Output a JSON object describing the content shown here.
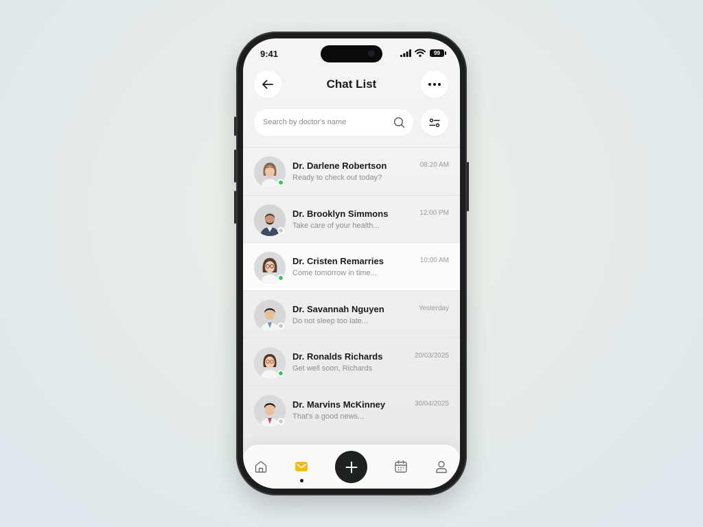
{
  "status_bar": {
    "time": "9:41",
    "battery": "99"
  },
  "header": {
    "title": "Chat List"
  },
  "search": {
    "placeholder": "Search by doctor's name"
  },
  "chats": [
    {
      "name": "Dr. Darlene Robertson",
      "message": "Ready to check out today?",
      "time": "08:20 AM",
      "online": true
    },
    {
      "name": "Dr. Brooklyn Simmons",
      "message": "Take care of your health...",
      "time": "12:00 PM",
      "online": false
    },
    {
      "name": "Dr. Cristen Remarries",
      "message": "Come tomorrow in time...",
      "time": "10:00 AM",
      "online": true
    },
    {
      "name": "Dr. Savannah Nguyen",
      "message": "Do not sleep too late...",
      "time": "Yesterday",
      "online": false
    },
    {
      "name": "Dr. Ronalds Richards",
      "message": "Get well soon, Richards",
      "time": "20/03/2025",
      "online": true
    },
    {
      "name": "Dr. Marvins McKinney",
      "message": "That's a good news...",
      "time": "30/04/2025",
      "online": false
    }
  ],
  "tab_bar": {
    "items": [
      {
        "icon": "home-icon"
      },
      {
        "icon": "mail-icon",
        "active": true
      },
      {
        "icon": "plus-icon"
      },
      {
        "icon": "calendar-icon"
      },
      {
        "icon": "profile-icon"
      }
    ]
  },
  "colors": {
    "accent": "#f5b921",
    "online": "#34c759",
    "fab": "#1d211f"
  }
}
